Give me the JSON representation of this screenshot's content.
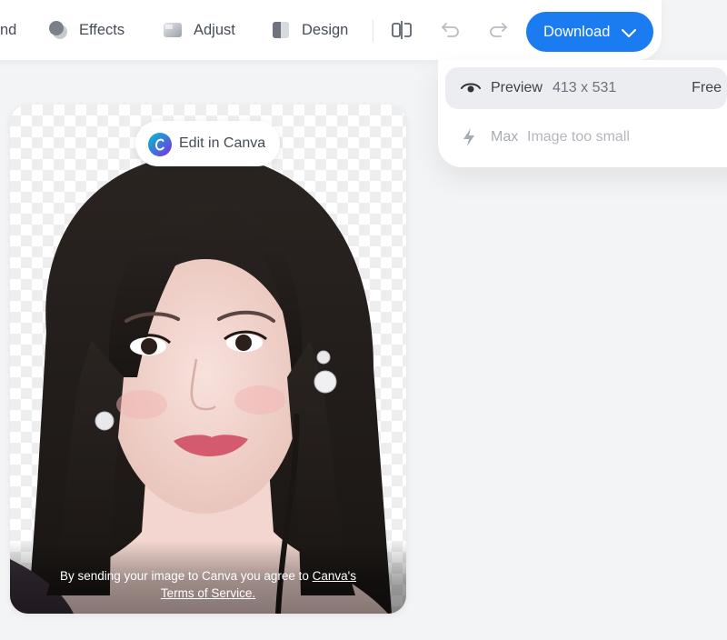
{
  "toolbar": {
    "partial_label": "nd",
    "effects_label": "Effects",
    "adjust_label": "Adjust",
    "design_label": "Design",
    "download_label": "Download"
  },
  "download_menu": {
    "preview": {
      "label": "Preview",
      "size": "413 x 531",
      "price": "Free"
    },
    "max": {
      "label": "Max",
      "note": "Image too small"
    }
  },
  "canvas": {
    "edit_button_label": "Edit in Canva",
    "caption_prefix": "By sending your image to Canva you agree to",
    "caption_link_1": "Canva's",
    "caption_link_2": "Terms of Service."
  },
  "colors": {
    "accent": "#1a7cf0",
    "canva_logo_a": "#00c4cc",
    "canva_logo_b": "#7d2ae8"
  },
  "icons": {
    "effects": "effects-icon",
    "adjust": "adjust-icon",
    "design": "design-icon",
    "compare": "compare-icon",
    "undo": "undo-icon",
    "redo": "redo-icon",
    "preview": "eye-icon",
    "max": "bolt-icon"
  }
}
